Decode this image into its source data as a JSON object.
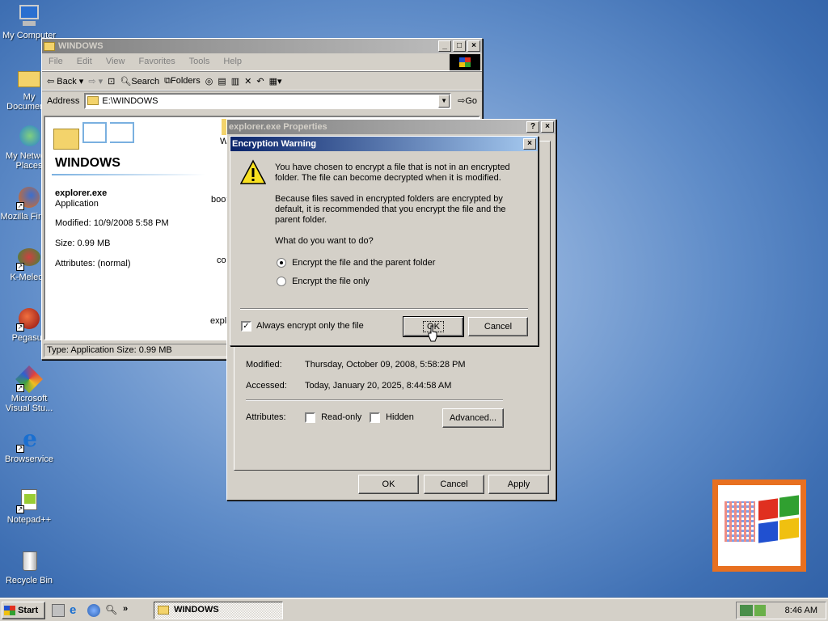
{
  "desktop": {
    "icons": [
      {
        "label": "My Computer"
      },
      {
        "label": "My Documents"
      },
      {
        "label": "My Network Places"
      },
      {
        "label": "Mozilla Firefox"
      },
      {
        "label": "K-Meleon"
      },
      {
        "label": "Pegasus"
      },
      {
        "label": "Microsoft Visual Stu..."
      },
      {
        "label": "Browservice"
      },
      {
        "label": "Notepad++"
      },
      {
        "label": "Recycle Bin"
      }
    ]
  },
  "explorer": {
    "title": "WINDOWS",
    "menu": [
      "File",
      "Edit",
      "View",
      "Favorites",
      "Tools",
      "Help"
    ],
    "toolbar": {
      "back": "Back",
      "search": "Search",
      "folders": "Folders"
    },
    "address_label": "Address",
    "address_value": "E:\\WINDOWS",
    "go": "Go",
    "folder_heading": "WINDOWS",
    "file_name": "explorer.exe",
    "file_type": "Application",
    "modified": "Modified: 10/9/2008 5:58 PM",
    "size": "Size: 0.99 MB",
    "attributes": "Attributes: (normal)",
    "partial_items": [
      "W",
      "boot",
      "con",
      "explo"
    ],
    "status": "Type: Application Size: 0.99 MB"
  },
  "properties": {
    "title": "explorer.exe Properties",
    "modified_label": "Modified:",
    "modified_value": "Thursday, October 09, 2008, 5:58:28 PM",
    "accessed_label": "Accessed:",
    "accessed_value": "Today, January 20, 2025, 8:44:58 AM",
    "attributes_label": "Attributes:",
    "readonly": "Read-only",
    "hidden": "Hidden",
    "advanced": "Advanced...",
    "ok": "OK",
    "cancel": "Cancel",
    "apply": "Apply"
  },
  "warning": {
    "title": "Encryption Warning",
    "para1": "You have chosen to encrypt a file that is not in an encrypted folder. The file can become decrypted when it is modified.",
    "para2": "Because files saved in encrypted folders are encrypted by default, it is recommended that you encrypt the file and the parent folder.",
    "question": "What do you want to do?",
    "option1": "Encrypt the file and the parent folder",
    "option2": "Encrypt the file only",
    "selected_option": 1,
    "always_checkbox": "Always encrypt only the file",
    "always_checked": true,
    "ok": "OK",
    "cancel": "Cancel"
  },
  "taskbar": {
    "start": "Start",
    "task": "WINDOWS",
    "time": "8:46 AM"
  }
}
